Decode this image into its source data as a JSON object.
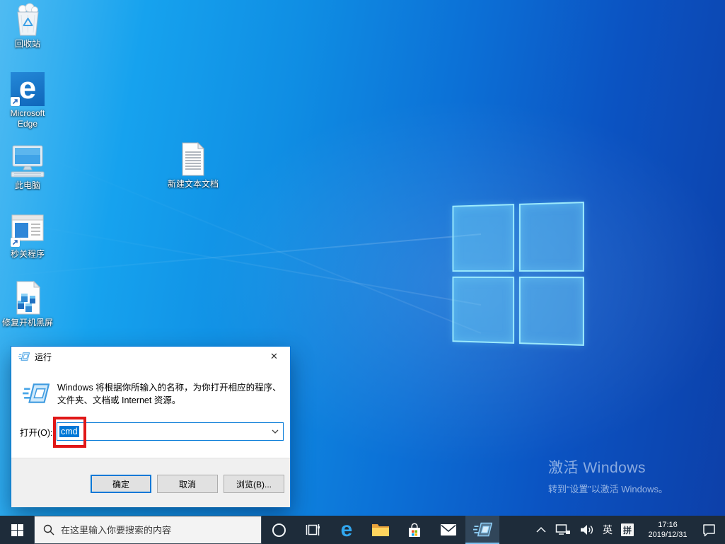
{
  "colors": {
    "accent": "#0078d7",
    "annotation_red": "#e01717",
    "taskbar_bg": "#1e2c3a",
    "selection_bg": "#0078d7"
  },
  "desktop": {
    "icons": [
      {
        "name": "recycle-bin",
        "label": "回收站"
      },
      {
        "name": "microsoft-edge",
        "label": "Microsoft Edge"
      },
      {
        "name": "this-pc",
        "label": "此电脑"
      },
      {
        "name": "quick-close-program",
        "label": "秒关程序"
      },
      {
        "name": "fix-boot-black-screen",
        "label": "修复开机黑屏"
      },
      {
        "name": "new-text-document",
        "label": "新建文本文档"
      }
    ],
    "watermark": {
      "title": "激活 Windows",
      "subtitle": "转到“设置”以激活 Windows。"
    }
  },
  "run_dialog": {
    "title": "运行",
    "close_glyph": "✕",
    "message_line1": "Windows 将根据你所输入的名称，为你打开相应的程序、",
    "message_line2": "文件夹、文档或 Internet 资源。",
    "open_label": "打开(O):",
    "input_value": "cmd",
    "buttons": {
      "ok": "确定",
      "cancel": "取消",
      "browse": "浏览(B)..."
    }
  },
  "taskbar": {
    "search_placeholder": "在这里输入你要搜索的内容",
    "items": [
      "start",
      "search",
      "cortana",
      "task-view",
      "edge",
      "file-explorer",
      "store",
      "mail",
      "run-active"
    ],
    "tray": {
      "lang": "英",
      "ime": "拼",
      "time": "17:16",
      "date": "2019/12/31"
    }
  }
}
